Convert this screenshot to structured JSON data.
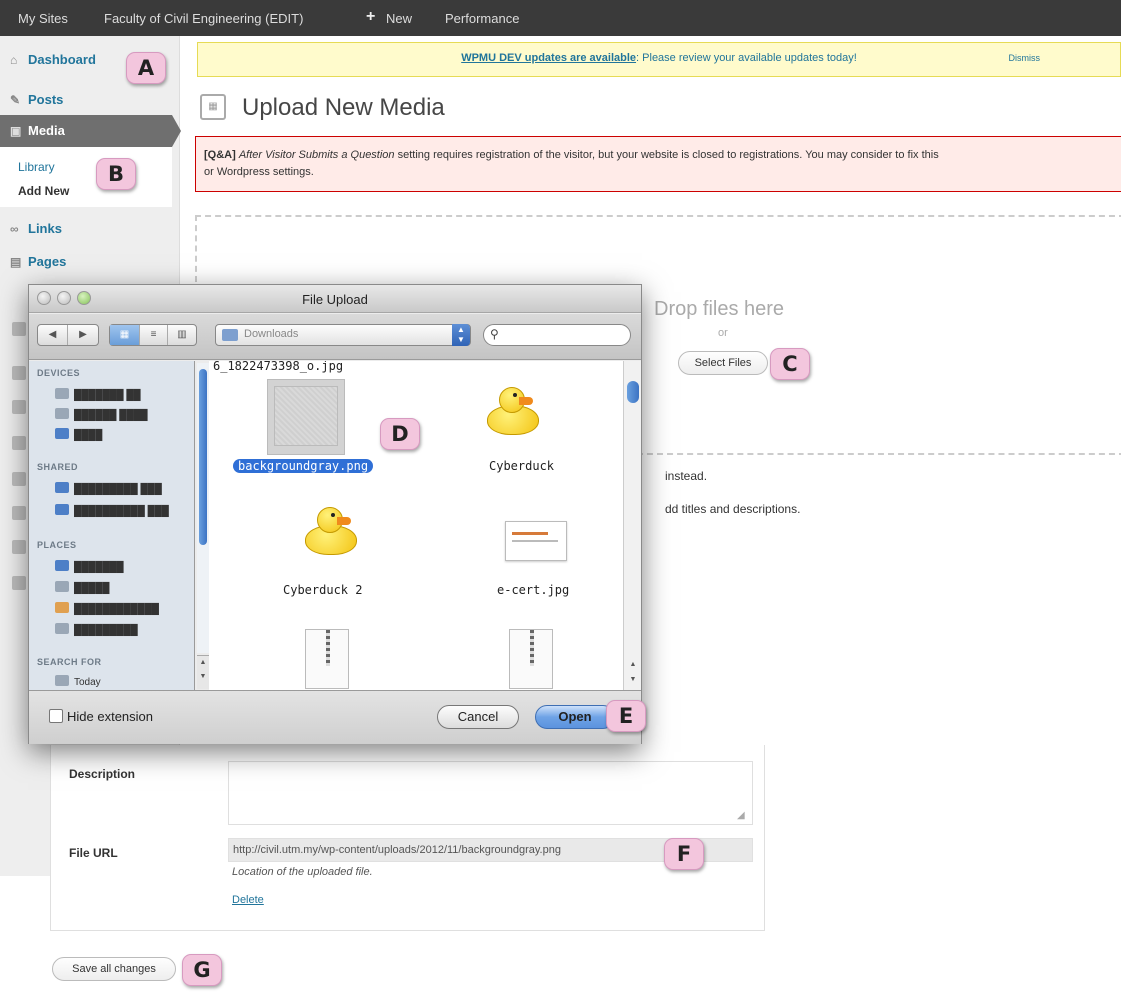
{
  "admin_bar": {
    "my_sites": "My Sites",
    "site_name": "Faculty of Civil Engineering (EDIT)",
    "new_icon": "plus-icon",
    "new_label": "New",
    "performance": "Performance"
  },
  "sidebar": {
    "dashboard": "Dashboard",
    "posts": "Posts",
    "media": "Media",
    "library": "Library",
    "add_new": "Add New",
    "links": "Links",
    "pages": "Pages"
  },
  "callouts": [
    "A",
    "B",
    "C",
    "D",
    "E",
    "F",
    "G"
  ],
  "update_notice": {
    "link_text": "WPMU DEV updates are available",
    "text": ": Please review your available updates today!",
    "dismiss": "Dismiss"
  },
  "page_title": "Upload New Media",
  "error_notice": {
    "tag": "[Q&A]",
    "setting": "After Visitor Submits a Question",
    "text_line1": " setting requires registration of the visitor, but your website is closed to registrations. You may consider to fix this",
    "text_line2": "or Wordpress settings."
  },
  "uploader": {
    "drop_text": "Drop files here",
    "or_text": "or",
    "select_files": "Select Files",
    "background_line1": "instead.",
    "background_line2": "dd titles and descriptions."
  },
  "dialog": {
    "title": "File Upload",
    "location": "Downloads",
    "search_placeholder": "",
    "sidebar_devices": "DEVICES",
    "sidebar_shared": "SHARED",
    "sidebar_places": "PLACES",
    "sidebar_search": "SEARCH FOR",
    "sidebar_today": "Today",
    "top_file": "6_1822473398_o.jpg",
    "files": [
      {
        "name": "backgroundgray.png",
        "selected": true
      },
      {
        "name": "Cyberduck",
        "selected": false
      },
      {
        "name": "Cyberduck 2",
        "selected": false
      },
      {
        "name": "e-cert.jpg",
        "selected": false
      }
    ],
    "hide_extension": "Hide extension",
    "cancel": "Cancel",
    "open": "Open"
  },
  "media_item": {
    "description_label": "Description",
    "description_value": "",
    "file_url_label": "File URL",
    "file_url_value": "http://civil.utm.my/wp-content/uploads/2012/11/backgroundgray.png",
    "file_url_help": "Location of the uploaded file.",
    "delete": "Delete"
  },
  "save_all_changes": "Save all changes",
  "colors": {
    "admin_bar": "#3a3a3a",
    "link_blue": "#21759b",
    "callout_pink": "#f3c6dd",
    "error_bg": "#ffebe8",
    "update_bg": "#fffbcc",
    "selection_blue": "#2f6fd6"
  }
}
